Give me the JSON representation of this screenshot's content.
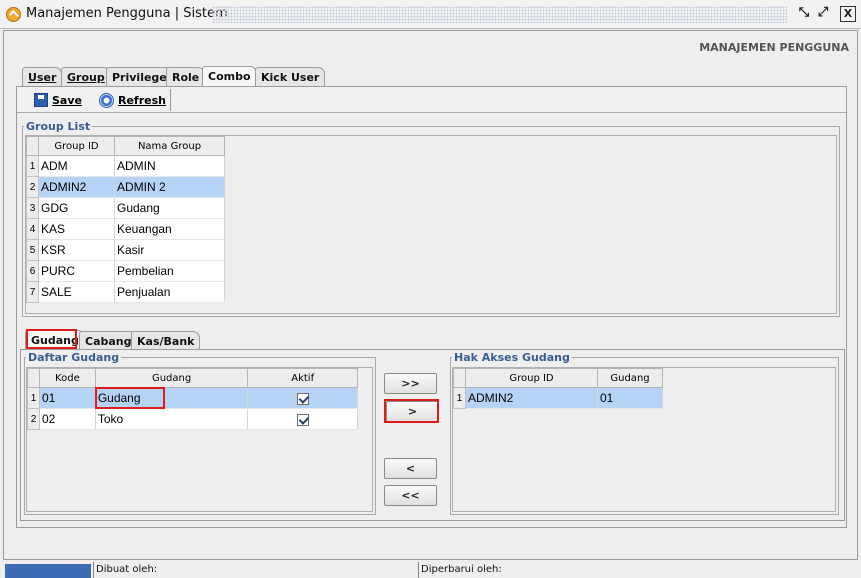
{
  "window": {
    "title": "Manajemen Pengguna | Sistem",
    "controls": {
      "restore_icon": "restore-icon",
      "maximize_icon": "maximize-icon",
      "close_label": "X"
    }
  },
  "header_label": "MANAJEMEN PENGGUNA",
  "main_tabs": [
    {
      "label": "User",
      "active": false
    },
    {
      "label": "Group",
      "active": false
    },
    {
      "label": "Privilege",
      "active": false
    },
    {
      "label": "Role",
      "active": false
    },
    {
      "label": "Combo",
      "active": true
    },
    {
      "label": "Kick User",
      "active": false
    }
  ],
  "toolbar": {
    "save_label": "Save",
    "refresh_label": "Refresh"
  },
  "group_list": {
    "title": "Group List",
    "columns": [
      "Group ID",
      "Nama Group"
    ],
    "rows": [
      {
        "no": "1",
        "id": "ADM",
        "name": "ADMIN"
      },
      {
        "no": "2",
        "id": "ADMIN2",
        "name": "ADMIN 2",
        "selected": true
      },
      {
        "no": "3",
        "id": "GDG",
        "name": "Gudang"
      },
      {
        "no": "4",
        "id": "KAS",
        "name": "Keuangan"
      },
      {
        "no": "5",
        "id": "KSR",
        "name": "Kasir"
      },
      {
        "no": "6",
        "id": "PURC",
        "name": "Pembelian"
      },
      {
        "no": "7",
        "id": "SALE",
        "name": "Penjualan"
      }
    ]
  },
  "sub_tabs": [
    {
      "label": "Gudang",
      "active": true
    },
    {
      "label": "Cabang",
      "active": false
    },
    {
      "label": "Kas/Bank",
      "active": false
    }
  ],
  "daftar_gudang": {
    "title": "Daftar Gudang",
    "columns": [
      "Kode",
      "Gudang",
      "Aktif"
    ],
    "rows": [
      {
        "no": "1",
        "kode": "01",
        "gudang": "Gudang",
        "aktif": true,
        "selected": true
      },
      {
        "no": "2",
        "kode": "02",
        "gudang": "Toko",
        "aktif": true
      }
    ]
  },
  "move_buttons": {
    "add_all": ">>",
    "add": ">",
    "remove": "<",
    "remove_all": "<<"
  },
  "hak_akses": {
    "title": "Hak Akses Gudang",
    "columns": [
      "Group ID",
      "Gudang"
    ],
    "rows": [
      {
        "no": "1",
        "group_id": "ADMIN2",
        "gudang": "01",
        "selected": true
      }
    ]
  },
  "status_bar": {
    "created_label": "Dibuat oleh:",
    "updated_label": "Diperbarui oleh:"
  },
  "colors": {
    "selection": "#b5d4f5",
    "highlight": "#e01b1b",
    "group_title": "#3a5d8f",
    "status_user": "#3d6bb3"
  }
}
